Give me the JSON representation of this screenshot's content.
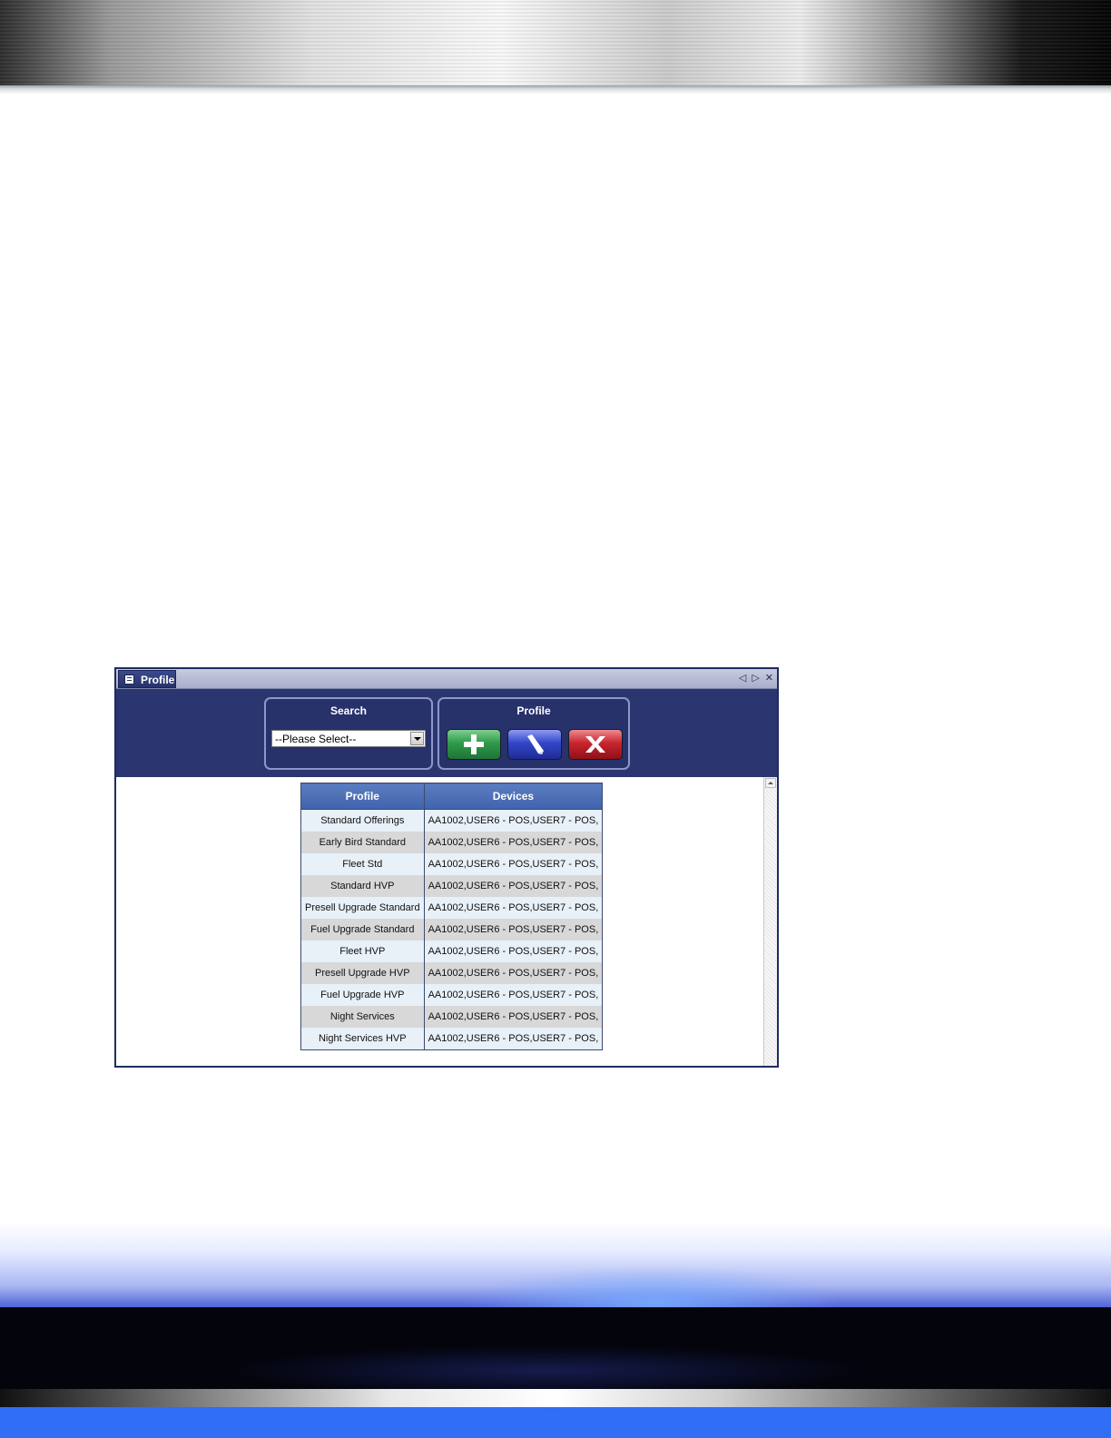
{
  "window": {
    "tab_title": "Profile",
    "tab_icon": "profile-window-icon",
    "controls": [
      "◁",
      "▷",
      "✕"
    ]
  },
  "search": {
    "title": "Search",
    "select_value": "--Please Select--"
  },
  "profile_actions": {
    "title": "Profile",
    "buttons": [
      {
        "name": "add",
        "icon": "plus-icon",
        "color": "#2e9a4a"
      },
      {
        "name": "edit",
        "icon": "pencil-icon",
        "color": "#3346c8"
      },
      {
        "name": "delete",
        "icon": "x-icon",
        "color": "#c8252e"
      }
    ]
  },
  "grid": {
    "columns": [
      "Profile",
      "Devices"
    ],
    "rows": [
      {
        "profile": "Standard Offerings",
        "devices": "AA1002,USER6 - POS,USER7 - POS,"
      },
      {
        "profile": "Early Bird Standard",
        "devices": "AA1002,USER6 - POS,USER7 - POS,"
      },
      {
        "profile": "Fleet Std",
        "devices": "AA1002,USER6 - POS,USER7 - POS,"
      },
      {
        "profile": "Standard HVP",
        "devices": "AA1002,USER6 - POS,USER7 - POS,"
      },
      {
        "profile": "Presell Upgrade Standard",
        "devices": "AA1002,USER6 - POS,USER7 - POS,"
      },
      {
        "profile": "Fuel Upgrade Standard",
        "devices": "AA1002,USER6 - POS,USER7 - POS,"
      },
      {
        "profile": "Fleet HVP",
        "devices": "AA1002,USER6 - POS,USER7 - POS,"
      },
      {
        "profile": "Presell Upgrade HVP",
        "devices": "AA1002,USER6 - POS,USER7 - POS,"
      },
      {
        "profile": "Fuel Upgrade HVP",
        "devices": "AA1002,USER6 - POS,USER7 - POS,"
      },
      {
        "profile": "Night Services",
        "devices": "AA1002,USER6 - POS,USER7 - POS,"
      },
      {
        "profile": "Night Services HVP",
        "devices": "AA1002,USER6 - POS,USER7 - POS,"
      }
    ]
  }
}
